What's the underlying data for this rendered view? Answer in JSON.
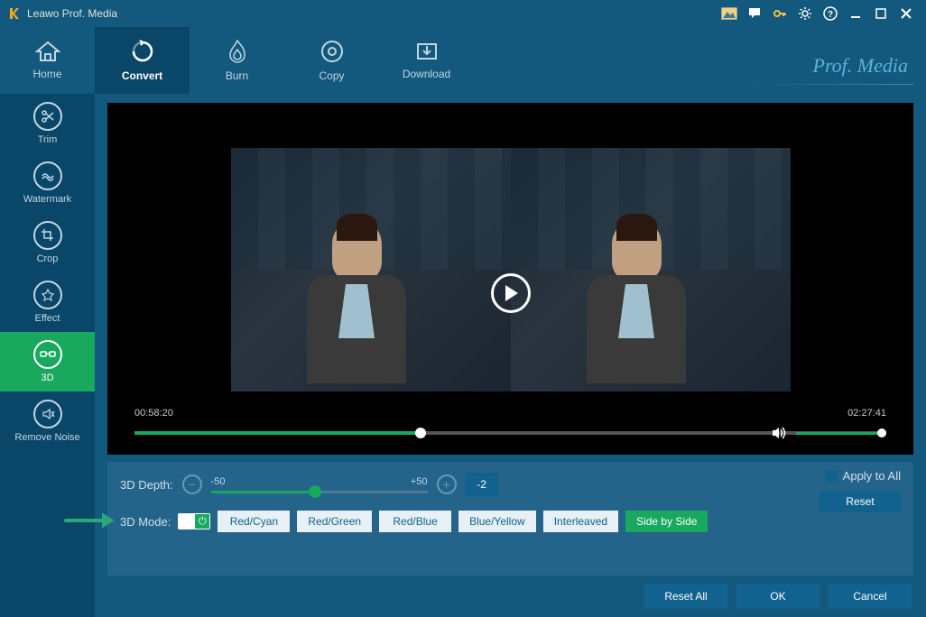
{
  "titlebar": {
    "title": "Leawo Prof. Media"
  },
  "toolbar": {
    "tabs": [
      {
        "label": "Home"
      },
      {
        "label": "Convert"
      },
      {
        "label": "Burn"
      },
      {
        "label": "Copy"
      },
      {
        "label": "Download"
      }
    ],
    "brand": "Prof. Media"
  },
  "sidebar": {
    "items": [
      {
        "label": "Trim"
      },
      {
        "label": "Watermark"
      },
      {
        "label": "Crop"
      },
      {
        "label": "Effect"
      },
      {
        "label": "3D"
      },
      {
        "label": "Remove Noise"
      }
    ]
  },
  "player": {
    "current_time": "00:58:20",
    "total_time": "02:27:41",
    "progress_percent": 38,
    "volume_percent": 100
  },
  "depth": {
    "label": "3D Depth:",
    "min_label": "-50",
    "max_label": "+50",
    "value": "-2",
    "slider_percent": 48
  },
  "mode": {
    "label": "3D Mode:",
    "toggle_on": true,
    "options": [
      {
        "label": "Red/Cyan",
        "active": false
      },
      {
        "label": "Red/Green",
        "active": false
      },
      {
        "label": "Red/Blue",
        "active": false
      },
      {
        "label": "Blue/Yellow",
        "active": false
      },
      {
        "label": "Interleaved",
        "active": false
      },
      {
        "label": "Side by Side",
        "active": true
      }
    ]
  },
  "apply": {
    "label": "Apply to All",
    "checked": false,
    "reset_label": "Reset"
  },
  "footer": {
    "reset_all": "Reset All",
    "ok": "OK",
    "cancel": "Cancel"
  }
}
